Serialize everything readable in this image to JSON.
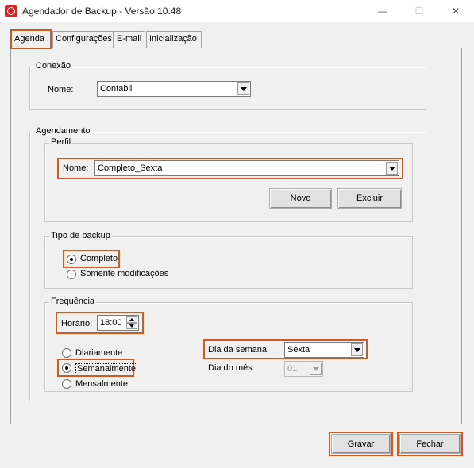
{
  "window": {
    "title": "Agendador de Backup - Versão 10.48",
    "minimize": "—",
    "maximize": "☐",
    "close": "✕"
  },
  "tabs": [
    {
      "label": "Agenda"
    },
    {
      "label": "Configurações"
    },
    {
      "label": "E-mail"
    },
    {
      "label": "Inicialização"
    }
  ],
  "conexao": {
    "group_label": "Conexão",
    "nome_label": "Nome:",
    "nome_value": "Contabil"
  },
  "agendamento": {
    "group_label": "Agendamento",
    "perfil": {
      "group_label": "Perfil",
      "nome_label": "Nome:",
      "nome_value": "Completo_Sexta",
      "novo_button": "Novo",
      "excluir_button": "Excluir"
    },
    "tipo_backup": {
      "group_label": "Tipo de backup",
      "completo": "Completo",
      "somente_modificacoes": "Somente modificações",
      "selected": "Completo"
    },
    "frequencia": {
      "group_label": "Frequência",
      "horario_label": "Horário:",
      "horario_value": "18:00",
      "diariamente": "Diariamente",
      "semanalmente": "Semanalmente",
      "mensalmente": "Mensalmente",
      "selected": "Semanalmente",
      "dia_semana_label": "Dia da semana:",
      "dia_semana_value": "Sexta",
      "dia_mes_label": "Dia do mês:",
      "dia_mes_value": "01"
    }
  },
  "footer": {
    "gravar_button": "Gravar",
    "fechar_button": "Fechar"
  },
  "colors": {
    "highlight": "#d35a1e",
    "app_icon": "#cc2a2a"
  }
}
